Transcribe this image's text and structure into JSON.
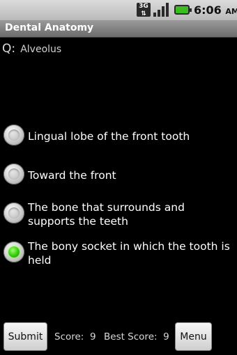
{
  "status_bar": {
    "network_label": "3G",
    "time": "6:06",
    "ampm": "AM"
  },
  "app": {
    "title": "Dental Anatomy"
  },
  "question": {
    "prefix": "Q:",
    "text": "Alveolus"
  },
  "options": [
    {
      "label": "Lingual lobe of the front tooth",
      "selected": false
    },
    {
      "label": "Toward the front",
      "selected": false
    },
    {
      "label": "The bone that surrounds and supports the teeth",
      "selected": false
    },
    {
      "label": "The bony socket in which the tooth is held",
      "selected": true
    }
  ],
  "footer": {
    "submit_label": "Submit",
    "score_label": "Score:",
    "score_value": "9",
    "best_score_label": "Best Score:",
    "best_score_value": "9",
    "menu_label": "Menu"
  },
  "colors": {
    "selected_radio": "#3ccf12",
    "title_bar": "#7d7d7d"
  }
}
